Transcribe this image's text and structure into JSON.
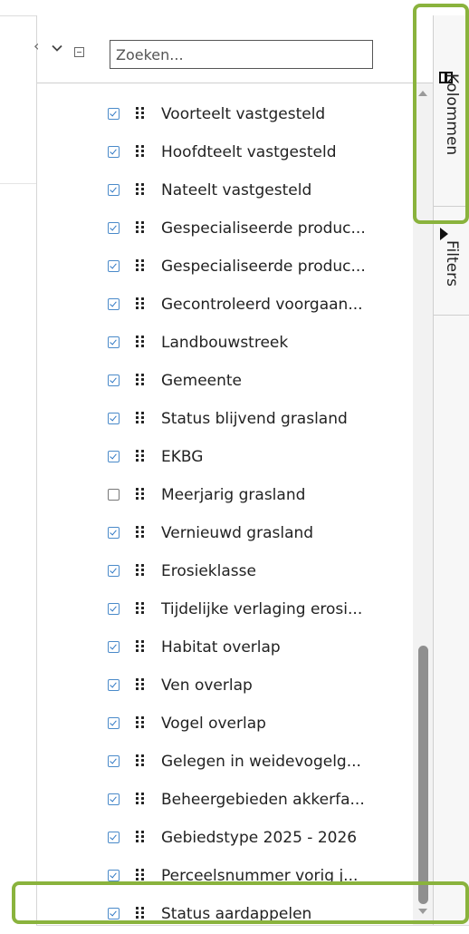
{
  "search": {
    "placeholder": "Zoeken..."
  },
  "columns": [
    {
      "label": "Voorteelt vastgesteld",
      "checked": true
    },
    {
      "label": "Hoofdteelt vastgesteld",
      "checked": true
    },
    {
      "label": "Nateelt vastgesteld",
      "checked": true
    },
    {
      "label": "Gespecialiseerde produc...",
      "checked": true
    },
    {
      "label": "Gespecialiseerde produc...",
      "checked": true
    },
    {
      "label": "Gecontroleerd voorgaan...",
      "checked": true
    },
    {
      "label": "Landbouwstreek",
      "checked": true
    },
    {
      "label": "Gemeente",
      "checked": true
    },
    {
      "label": "Status blijvend grasland",
      "checked": true
    },
    {
      "label": "EKBG",
      "checked": true
    },
    {
      "label": "Meerjarig grasland",
      "checked": false
    },
    {
      "label": "Vernieuwd grasland",
      "checked": true
    },
    {
      "label": "Erosieklasse",
      "checked": true
    },
    {
      "label": "Tijdelijke verlaging erosi...",
      "checked": true
    },
    {
      "label": "Habitat overlap",
      "checked": true
    },
    {
      "label": "Ven overlap",
      "checked": true
    },
    {
      "label": "Vogel overlap",
      "checked": true
    },
    {
      "label": "Gelegen in weidevogelg...",
      "checked": true
    },
    {
      "label": "Beheergebieden akkerfa...",
      "checked": true
    },
    {
      "label": "Gebiedstype 2025 - 2026",
      "checked": true
    },
    {
      "label": "Perceelsnummer vorig j...",
      "checked": true
    },
    {
      "label": "Status aardappelen",
      "checked": true
    }
  ],
  "side_tabs": {
    "columns_label": "Kolommen",
    "filters_label": "Filters"
  },
  "colors": {
    "highlight": "#8ab33d",
    "checkbox": "#2f78c4"
  }
}
